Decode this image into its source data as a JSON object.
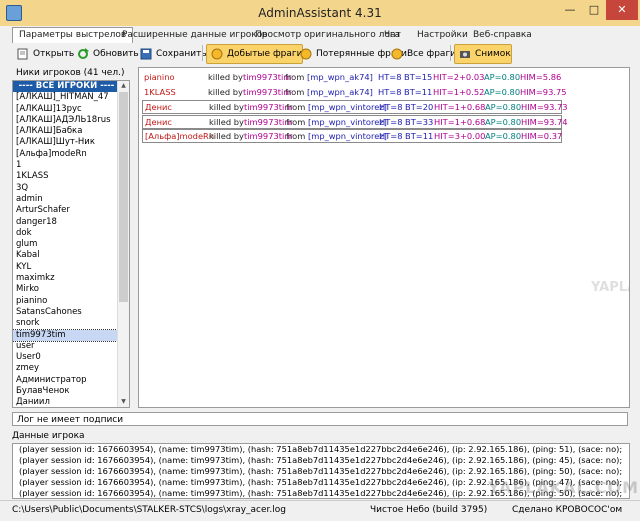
{
  "window": {
    "title": "AdminAssistant 4.31"
  },
  "tabs": [
    {
      "label": "Параметры выстрелов"
    },
    {
      "label": "Расширенные данные игроков"
    },
    {
      "label": "Просмотр оригинального лога"
    },
    {
      "label": "Чат"
    },
    {
      "label": "Настройки"
    },
    {
      "label": "Веб-справка"
    }
  ],
  "toolbar": {
    "open": "Открыть",
    "refresh": "Обновить",
    "save": "Сохранить",
    "got_frags": "Добытые фраги",
    "lost_frags": "Потерянные фраги",
    "all_frags": "Все фраги",
    "snapshot": "Снимок"
  },
  "players": {
    "label": "Ники игроков (41 чел.)",
    "items": [
      "---- ВСЕ ИГРОКИ ----",
      "[АЛКАШ]_HITMAN_47",
      "[АЛКАШ]13рус",
      "[АЛКАШ]АДЭЛЬ18rus",
      "[АЛКАШ]Бабка",
      "[АЛКАШ]Шут-Ник",
      "[Альфа]modeRn",
      "1",
      "1KLASS",
      "3Q",
      "admin",
      "ArturSchafer",
      "danger18",
      "dok",
      "glum",
      "Kabal",
      "KYL",
      "maximkz",
      "Mirko",
      "pianino",
      "SatansCahones",
      "snork",
      "tim9973tim",
      "user",
      "User0",
      "zmey",
      "Администратор",
      "БулавЧенок",
      "Даниил"
    ]
  },
  "log": {
    "rows": [
      {
        "victim": "pianino",
        "killed": "killed by",
        "killer": "tim9973tim",
        "from": "from",
        "weapon": "[mp_wpn_ak74]",
        "ht": "HT=8",
        "bt": "BT=15",
        "hit": "HIT=2+0.03",
        "ap": "AP=0.80",
        "him": "HIM=5.86"
      },
      {
        "victim": "1KLASS",
        "killed": "killed by",
        "killer": "tim9973tim",
        "from": "from",
        "weapon": "[mp_wpn_ak74]",
        "ht": "HT=8",
        "bt": "BT=11",
        "hit": "HIT=1+0.52",
        "ap": "AP=0.80",
        "him": "HIM=93.75"
      },
      {
        "victim": "Денис",
        "killed": "killed by",
        "killer": "tim9973tim",
        "from": "from",
        "weapon": "[mp_wpn_vintorez]",
        "ht": "HT=8",
        "bt": "BT=20",
        "hit": "HIT=1+0.68",
        "ap": "AP=0.80",
        "him": "HIM=93.73"
      },
      {
        "victim": "Денис",
        "killed": "killed by",
        "killer": "tim9973tim",
        "from": "from",
        "weapon": "[mp_wpn_vintorez]",
        "ht": "HT=8",
        "bt": "BT=33",
        "hit": "HIT=1+0.68",
        "ap": "AP=0.80",
        "him": "HIM=93.74"
      },
      {
        "victim": "[Альфа]modeRn",
        "killed": "killed by",
        "killer": "tim9973tim",
        "from": "from",
        "weapon": "[mp_wpn_vintorez]",
        "ht": "HT=8",
        "bt": "BT=11",
        "hit": "HIT=3+0.00",
        "ap": "AP=0.80",
        "him": "HIM=0.37"
      }
    ]
  },
  "signature": "Лог не имеет подписи",
  "player_data": {
    "label": "Данные игрока",
    "lines": [
      "(player session id: 1676603954), (name: tim9973tim), (hash: 751a8eb7d11435e1d227bbc2d4e6e246), (ip: 2.92.165.186), (ping: 51), (sace: no);",
      "(player session id: 1676603954), (name: tim9973tim), (hash: 751a8eb7d11435e1d227bbc2d4e6e246), (ip: 2.92.165.186), (ping: 45), (sace: no);",
      "(player session id: 1676603954), (name: tim9973tim), (hash: 751a8eb7d11435e1d227bbc2d4e6e246), (ip: 2.92.165.186), (ping: 50), (sace: no);",
      "(player session id: 1676603954), (name: tim9973tim), (hash: 751a8eb7d11435e1d227bbc2d4e6e246), (ip: 2.92.165.186), (ping: 47), (sace: no);",
      "(player session id: 1676603954), (name: tim9973tim), (hash: 751a8eb7d11435e1d227bbc2d4e6e246), (ip: 2.92.165.186), (ping: 50), (sace: no);"
    ]
  },
  "statusbar": {
    "path": "C:\\Users\\Public\\Documents\\STALKER-STCS\\logs\\xray_acer.log",
    "map": "Чистое Небо (build 3795)",
    "credit": "Сделано КРОВОСОС'ом"
  },
  "watermark": {
    "text": "YAPLAKAL.COM",
    "text2": "YAPLAKAL.COM"
  },
  "colors": {
    "titlebar": "#f4d58c",
    "pressed": "#fbd36b",
    "selected_header": "#1d5aa8",
    "victim": "#c01818",
    "weapon": "#2020b0",
    "stat": "#b00090",
    "stat2": "#008080"
  }
}
